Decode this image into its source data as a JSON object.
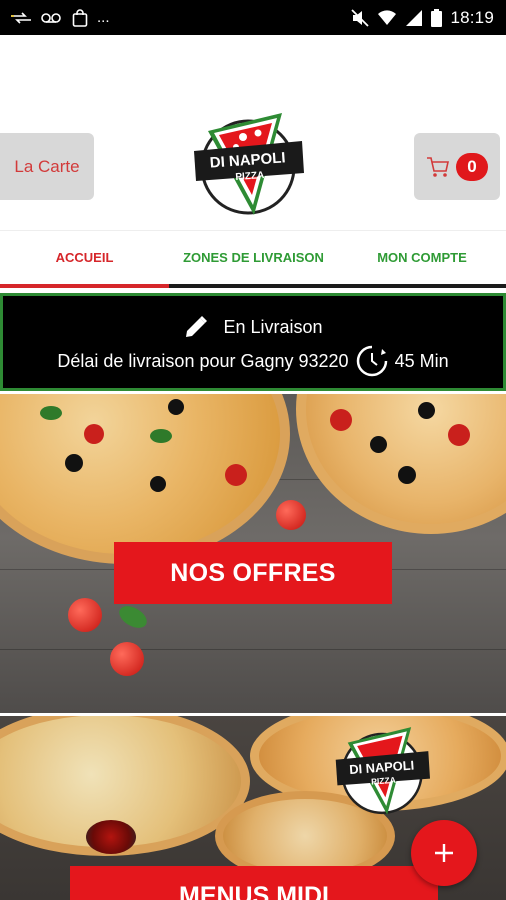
{
  "status_bar": {
    "time": "18:19",
    "ellipsis": "...",
    "icons": [
      "signal-arrows-icon",
      "voicemail-icon",
      "shopping-bag-icon",
      "mute-icon",
      "wifi-icon",
      "cellular-icon",
      "battery-icon"
    ]
  },
  "header": {
    "menu_button_label": "La Carte",
    "cart_count": "0",
    "logo": {
      "line1": "DI NAPOLI",
      "line2": "PIZZA"
    }
  },
  "tabs": [
    {
      "label": "ACCUEIL",
      "active": true
    },
    {
      "label": "ZONES DE LIVRAISON",
      "active": false
    },
    {
      "label": "MON COMPTE",
      "active": false
    }
  ],
  "delivery": {
    "mode": "En Livraison",
    "delay_text": "Délai de livraison pour Gagny 93220",
    "delay_time": "45 Min"
  },
  "promos": [
    {
      "label": "NOS OFFRES"
    },
    {
      "label": "MENUS MIDI"
    }
  ],
  "colors": {
    "accent_red": "#e4171c",
    "green": "#2e8b34",
    "tab_red": "#d6262a"
  }
}
